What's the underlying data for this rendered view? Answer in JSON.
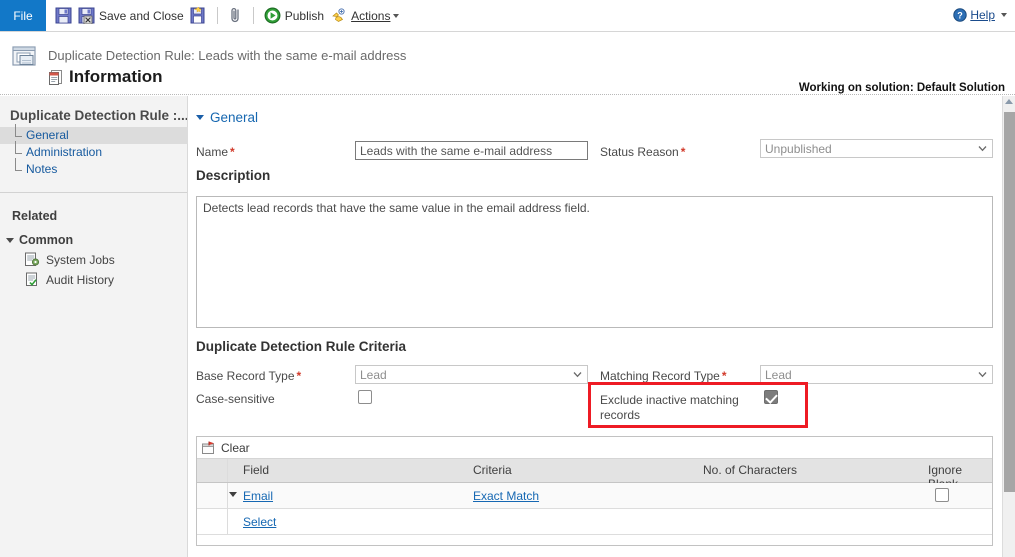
{
  "ribbon": {
    "file_tab": "File",
    "buttons": [
      {
        "name": "save-button",
        "label": "",
        "icon": "save-icon"
      },
      {
        "name": "save-and-close-button",
        "label": "Save and Close",
        "icon": "save-close-icon"
      },
      {
        "name": "save-as-new-button",
        "label": "",
        "icon": "new-record-icon"
      },
      {
        "name": "attach-button",
        "label": "",
        "icon": "paperclip-icon"
      },
      {
        "name": "publish-button",
        "label": "Publish",
        "icon": "publish-green-arrow-icon"
      },
      {
        "name": "actions-button",
        "label": "Actions",
        "icon": "actions-hand-icon"
      }
    ],
    "help_label": "Help"
  },
  "header": {
    "subtitle": "Duplicate Detection Rule: Leads with the same e-mail address",
    "title": "Information",
    "solution_note": "Working on solution: Default Solution"
  },
  "sidebar": {
    "heading": "Duplicate Detection Rule :...",
    "items": [
      {
        "label": "General",
        "selected": true
      },
      {
        "label": "Administration",
        "selected": false
      },
      {
        "label": "Notes",
        "selected": false
      }
    ],
    "related_label": "Related",
    "common_label": "Common",
    "common_items": [
      {
        "label": "System Jobs",
        "icon": "system-jobs-icon"
      },
      {
        "label": "Audit History",
        "icon": "audit-history-icon"
      }
    ]
  },
  "form": {
    "general_section": "General",
    "name_label": "Name",
    "name_value": "Leads with the same e-mail address",
    "status_reason_label": "Status Reason",
    "status_reason_value": "Unpublished",
    "description_label": "Description",
    "description_value": "Detects lead records that have the same value in the email address field.",
    "criteria_section": "Duplicate Detection Rule Criteria",
    "base_record_type_label": "Base Record Type",
    "base_record_type_value": "Lead",
    "matching_record_type_label": "Matching Record Type",
    "matching_record_type_value": "Lead",
    "case_sensitive_label": "Case-sensitive",
    "case_sensitive_checked": false,
    "exclude_inactive_label": "Exclude inactive matching records",
    "exclude_inactive_checked": true,
    "required_marker": "*"
  },
  "grid": {
    "clear_label": "Clear",
    "columns": [
      "Field",
      "Criteria",
      "No. of Characters",
      "Ignore Blank"
    ],
    "rows": [
      {
        "field": "Email",
        "criteria": "Exact Match",
        "chars": "",
        "ignore_blank_checked": false
      }
    ],
    "select_label": "Select"
  },
  "highlight": {
    "color": "#ee1b24"
  },
  "colors": {
    "file_tab_blue": "#1278c8",
    "link_blue": "#1668b3",
    "required_red": "#d13a2a",
    "highlight_red": "#ee1b24"
  }
}
